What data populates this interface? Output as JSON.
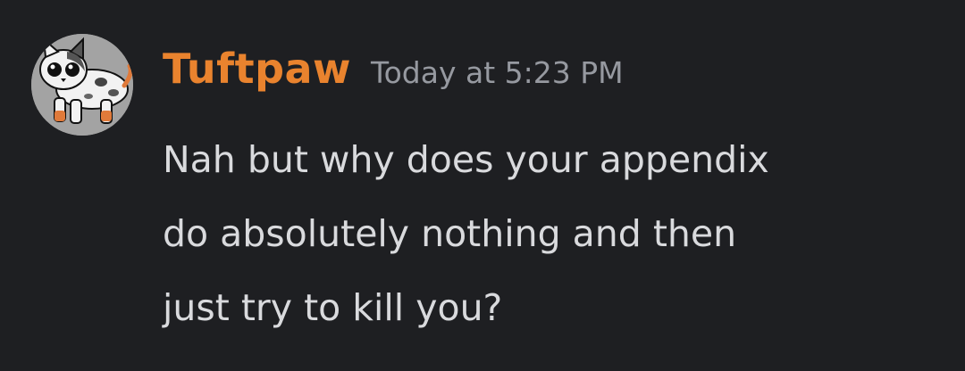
{
  "message": {
    "author": {
      "username": "Tuftpaw",
      "color": "#e9832e",
      "avatar_icon": "cat-avatar-icon"
    },
    "timestamp": "Today at 5:23 PM",
    "lines": [
      "Nah but why does your appendix",
      "do absolutely nothing and then",
      "just try to kill you?"
    ]
  },
  "theme": {
    "background": "#1e1f22",
    "text": "#d9dadd",
    "muted": "#9699a0"
  }
}
